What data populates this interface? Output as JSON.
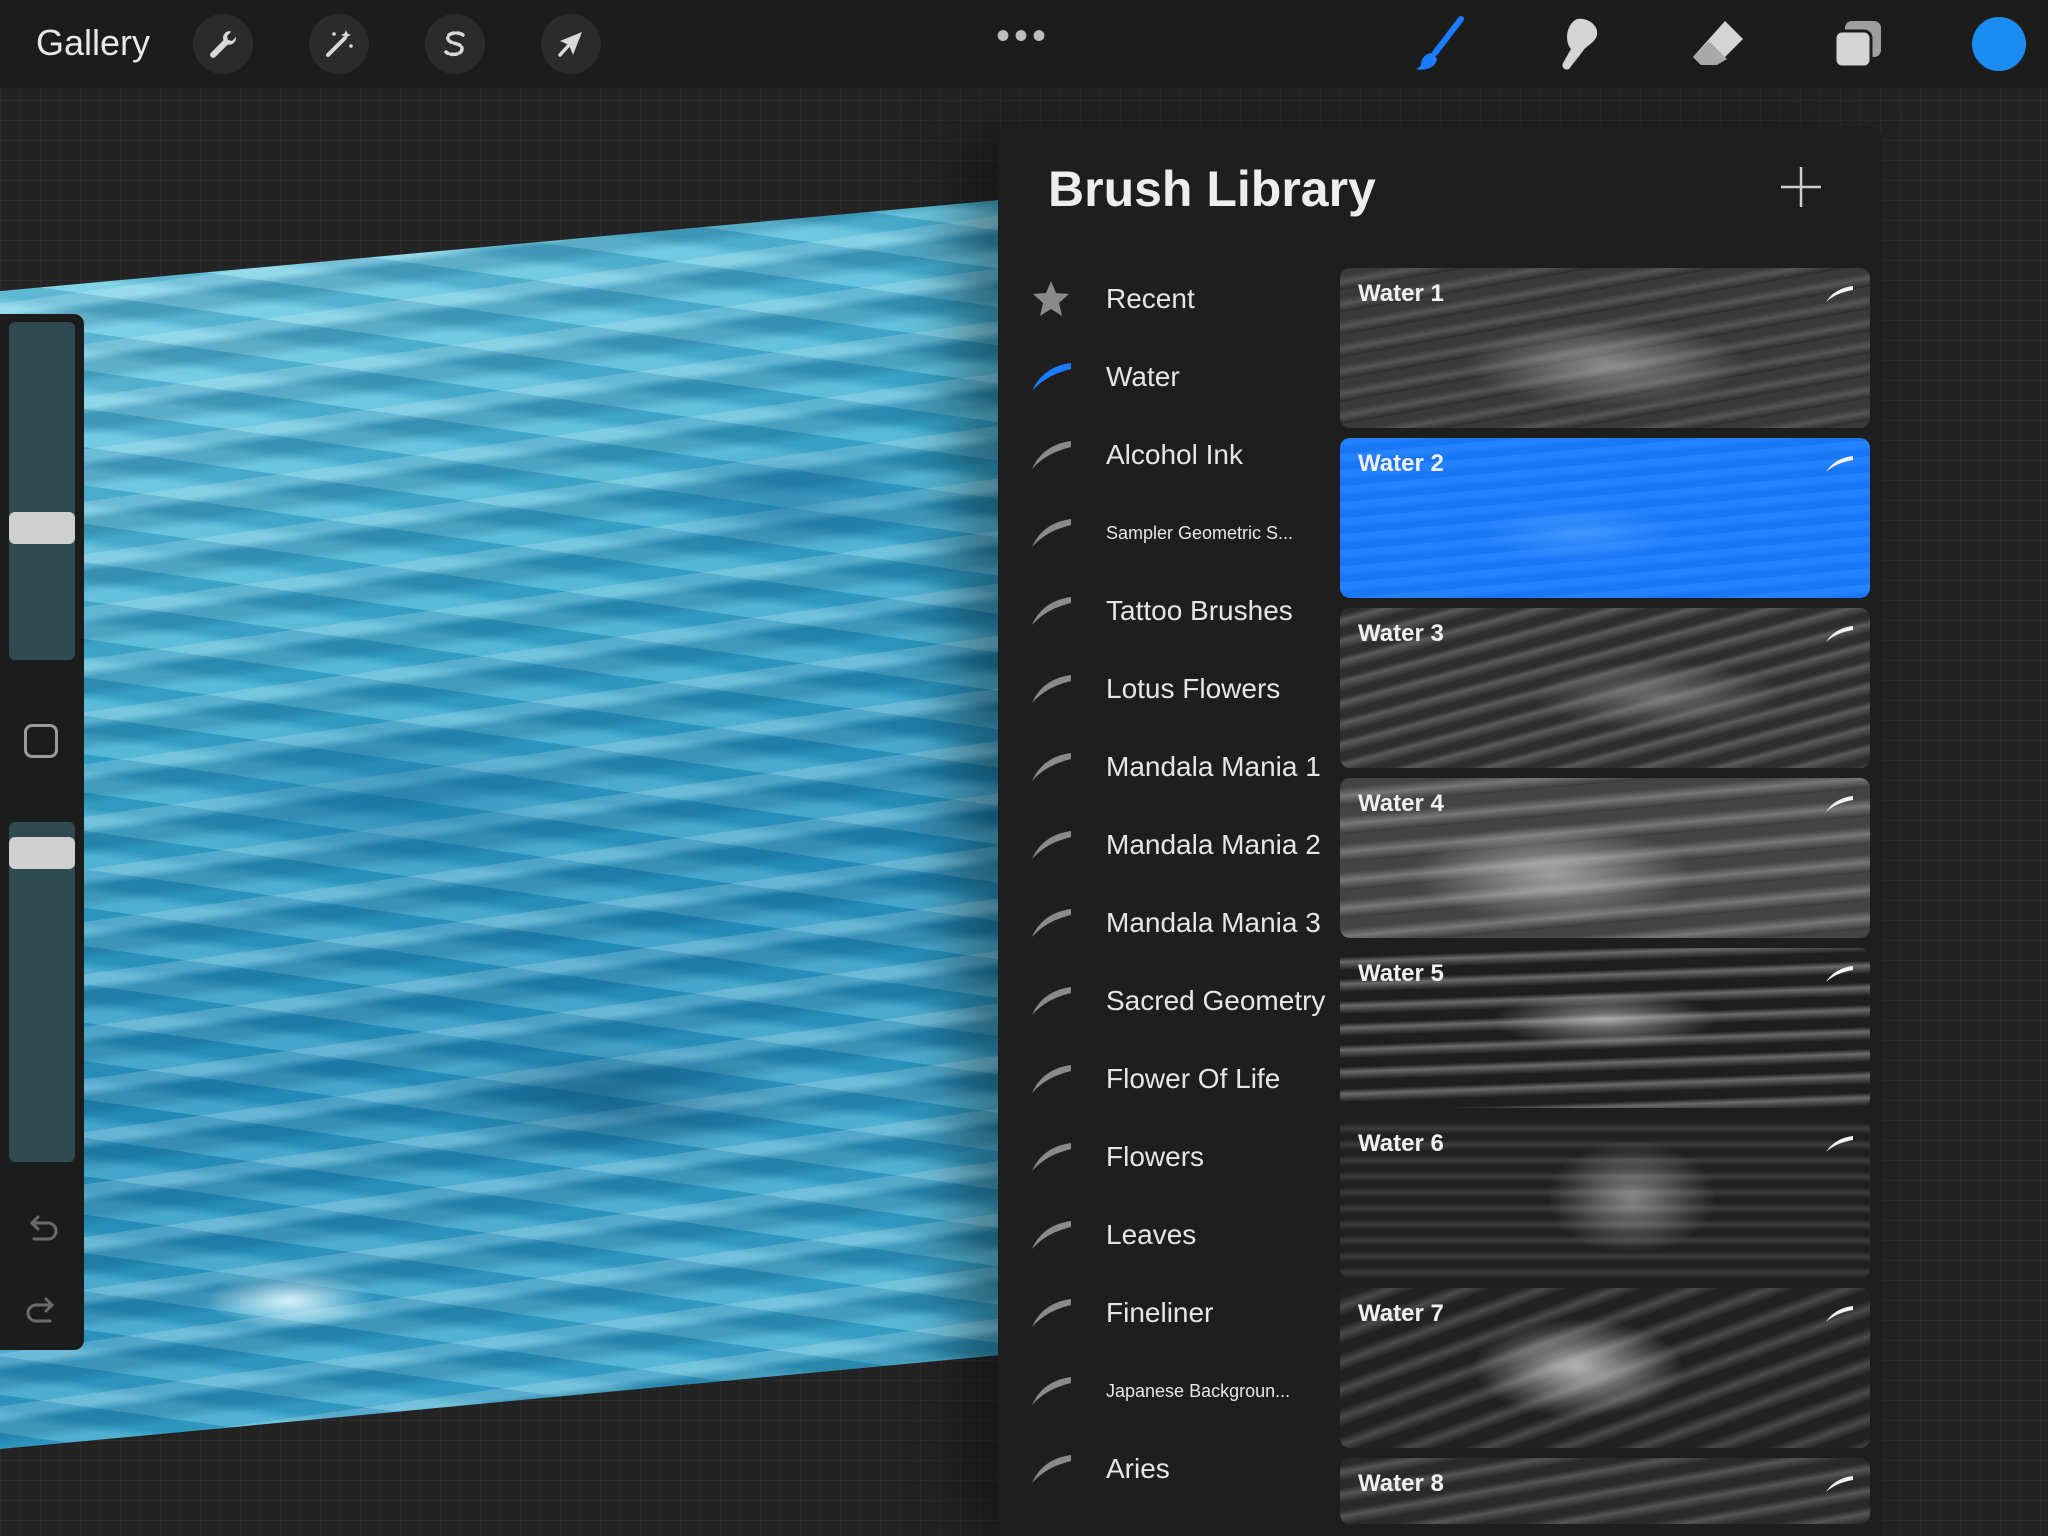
{
  "toolbar": {
    "gallery_label": "Gallery",
    "left_tools": [
      {
        "name": "adjustments",
        "icon": "wrench-icon"
      },
      {
        "name": "selection-wand",
        "icon": "magic-wand-icon"
      },
      {
        "name": "selection",
        "icon": "selection-s-icon"
      },
      {
        "name": "transform",
        "icon": "arrow-cursor-icon"
      }
    ],
    "more_label": "•••",
    "right_tools": [
      {
        "name": "brush",
        "icon": "brush-icon",
        "active": true
      },
      {
        "name": "smudge",
        "icon": "smudge-icon",
        "active": false
      },
      {
        "name": "eraser",
        "icon": "eraser-icon",
        "active": false
      },
      {
        "name": "layers",
        "icon": "layers-icon",
        "active": false
      }
    ],
    "current_color": "#1a8cf0",
    "accent_color": "#1a7cff"
  },
  "sidebar": {
    "brush_size_level": 0.38,
    "opacity_level": 0.95
  },
  "library": {
    "title": "Brush Library",
    "add_icon": "plus-icon",
    "sets": [
      {
        "label": "Recent",
        "icon": "star-icon",
        "active": false,
        "small": false
      },
      {
        "label": "Water",
        "icon": "brush-stroke-icon",
        "active": true,
        "small": false
      },
      {
        "label": "Alcohol Ink",
        "icon": "brush-stroke-icon",
        "active": false,
        "small": false
      },
      {
        "label": "Sampler Geometric S...",
        "icon": "brush-stroke-icon",
        "active": false,
        "small": true
      },
      {
        "label": "Tattoo Brushes",
        "icon": "brush-stroke-icon",
        "active": false,
        "small": false
      },
      {
        "label": "Lotus Flowers",
        "icon": "brush-stroke-icon",
        "active": false,
        "small": false
      },
      {
        "label": "Mandala Mania 1",
        "icon": "brush-stroke-icon",
        "active": false,
        "small": false
      },
      {
        "label": "Mandala Mania 2",
        "icon": "brush-stroke-icon",
        "active": false,
        "small": false
      },
      {
        "label": "Mandala Mania 3",
        "icon": "brush-stroke-icon",
        "active": false,
        "small": false
      },
      {
        "label": "Sacred Geometry",
        "icon": "brush-stroke-icon",
        "active": false,
        "small": false
      },
      {
        "label": "Flower Of Life",
        "icon": "brush-stroke-icon",
        "active": false,
        "small": false
      },
      {
        "label": "Flowers",
        "icon": "brush-stroke-icon",
        "active": false,
        "small": false
      },
      {
        "label": "Leaves",
        "icon": "brush-stroke-icon",
        "active": false,
        "small": false
      },
      {
        "label": "Fineliner",
        "icon": "brush-stroke-icon",
        "active": false,
        "small": false
      },
      {
        "label": "Japanese Backgroun...",
        "icon": "brush-stroke-icon",
        "active": false,
        "small": true
      },
      {
        "label": "Aries",
        "icon": "brush-stroke-icon",
        "active": false,
        "small": false
      }
    ],
    "brushes": [
      {
        "name": "Water 1",
        "selected": false
      },
      {
        "name": "Water 2",
        "selected": true
      },
      {
        "name": "Water 3",
        "selected": false
      },
      {
        "name": "Water 4",
        "selected": false
      },
      {
        "name": "Water 5",
        "selected": false
      },
      {
        "name": "Water 6",
        "selected": false
      },
      {
        "name": "Water 7",
        "selected": false
      },
      {
        "name": "Water 8",
        "selected": false
      }
    ]
  }
}
